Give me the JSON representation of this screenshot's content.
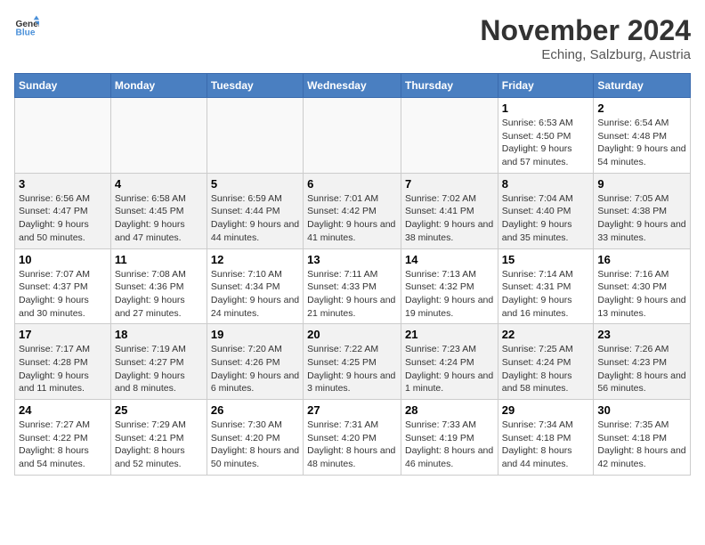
{
  "header": {
    "logo_line1": "General",
    "logo_line2": "Blue",
    "month_title": "November 2024",
    "location": "Eching, Salzburg, Austria"
  },
  "weekdays": [
    "Sunday",
    "Monday",
    "Tuesday",
    "Wednesday",
    "Thursday",
    "Friday",
    "Saturday"
  ],
  "weeks": [
    [
      {
        "day": "",
        "detail": ""
      },
      {
        "day": "",
        "detail": ""
      },
      {
        "day": "",
        "detail": ""
      },
      {
        "day": "",
        "detail": ""
      },
      {
        "day": "",
        "detail": ""
      },
      {
        "day": "1",
        "detail": "Sunrise: 6:53 AM\nSunset: 4:50 PM\nDaylight: 9 hours and 57 minutes."
      },
      {
        "day": "2",
        "detail": "Sunrise: 6:54 AM\nSunset: 4:48 PM\nDaylight: 9 hours and 54 minutes."
      }
    ],
    [
      {
        "day": "3",
        "detail": "Sunrise: 6:56 AM\nSunset: 4:47 PM\nDaylight: 9 hours and 50 minutes."
      },
      {
        "day": "4",
        "detail": "Sunrise: 6:58 AM\nSunset: 4:45 PM\nDaylight: 9 hours and 47 minutes."
      },
      {
        "day": "5",
        "detail": "Sunrise: 6:59 AM\nSunset: 4:44 PM\nDaylight: 9 hours and 44 minutes."
      },
      {
        "day": "6",
        "detail": "Sunrise: 7:01 AM\nSunset: 4:42 PM\nDaylight: 9 hours and 41 minutes."
      },
      {
        "day": "7",
        "detail": "Sunrise: 7:02 AM\nSunset: 4:41 PM\nDaylight: 9 hours and 38 minutes."
      },
      {
        "day": "8",
        "detail": "Sunrise: 7:04 AM\nSunset: 4:40 PM\nDaylight: 9 hours and 35 minutes."
      },
      {
        "day": "9",
        "detail": "Sunrise: 7:05 AM\nSunset: 4:38 PM\nDaylight: 9 hours and 33 minutes."
      }
    ],
    [
      {
        "day": "10",
        "detail": "Sunrise: 7:07 AM\nSunset: 4:37 PM\nDaylight: 9 hours and 30 minutes."
      },
      {
        "day": "11",
        "detail": "Sunrise: 7:08 AM\nSunset: 4:36 PM\nDaylight: 9 hours and 27 minutes."
      },
      {
        "day": "12",
        "detail": "Sunrise: 7:10 AM\nSunset: 4:34 PM\nDaylight: 9 hours and 24 minutes."
      },
      {
        "day": "13",
        "detail": "Sunrise: 7:11 AM\nSunset: 4:33 PM\nDaylight: 9 hours and 21 minutes."
      },
      {
        "day": "14",
        "detail": "Sunrise: 7:13 AM\nSunset: 4:32 PM\nDaylight: 9 hours and 19 minutes."
      },
      {
        "day": "15",
        "detail": "Sunrise: 7:14 AM\nSunset: 4:31 PM\nDaylight: 9 hours and 16 minutes."
      },
      {
        "day": "16",
        "detail": "Sunrise: 7:16 AM\nSunset: 4:30 PM\nDaylight: 9 hours and 13 minutes."
      }
    ],
    [
      {
        "day": "17",
        "detail": "Sunrise: 7:17 AM\nSunset: 4:28 PM\nDaylight: 9 hours and 11 minutes."
      },
      {
        "day": "18",
        "detail": "Sunrise: 7:19 AM\nSunset: 4:27 PM\nDaylight: 9 hours and 8 minutes."
      },
      {
        "day": "19",
        "detail": "Sunrise: 7:20 AM\nSunset: 4:26 PM\nDaylight: 9 hours and 6 minutes."
      },
      {
        "day": "20",
        "detail": "Sunrise: 7:22 AM\nSunset: 4:25 PM\nDaylight: 9 hours and 3 minutes."
      },
      {
        "day": "21",
        "detail": "Sunrise: 7:23 AM\nSunset: 4:24 PM\nDaylight: 9 hours and 1 minute."
      },
      {
        "day": "22",
        "detail": "Sunrise: 7:25 AM\nSunset: 4:24 PM\nDaylight: 8 hours and 58 minutes."
      },
      {
        "day": "23",
        "detail": "Sunrise: 7:26 AM\nSunset: 4:23 PM\nDaylight: 8 hours and 56 minutes."
      }
    ],
    [
      {
        "day": "24",
        "detail": "Sunrise: 7:27 AM\nSunset: 4:22 PM\nDaylight: 8 hours and 54 minutes."
      },
      {
        "day": "25",
        "detail": "Sunrise: 7:29 AM\nSunset: 4:21 PM\nDaylight: 8 hours and 52 minutes."
      },
      {
        "day": "26",
        "detail": "Sunrise: 7:30 AM\nSunset: 4:20 PM\nDaylight: 8 hours and 50 minutes."
      },
      {
        "day": "27",
        "detail": "Sunrise: 7:31 AM\nSunset: 4:20 PM\nDaylight: 8 hours and 48 minutes."
      },
      {
        "day": "28",
        "detail": "Sunrise: 7:33 AM\nSunset: 4:19 PM\nDaylight: 8 hours and 46 minutes."
      },
      {
        "day": "29",
        "detail": "Sunrise: 7:34 AM\nSunset: 4:18 PM\nDaylight: 8 hours and 44 minutes."
      },
      {
        "day": "30",
        "detail": "Sunrise: 7:35 AM\nSunset: 4:18 PM\nDaylight: 8 hours and 42 minutes."
      }
    ]
  ]
}
